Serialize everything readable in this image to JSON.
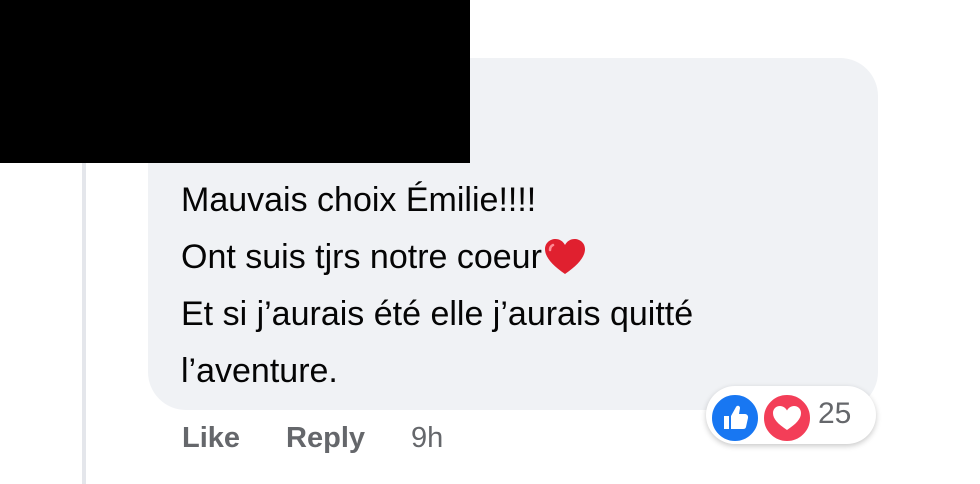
{
  "comment": {
    "lines": [
      "Mauvais choix Émilie!!!!",
      "Ont suis tjrs notre coeur",
      "Et si j’aurais été elle j’aurais quitté",
      "l’aventure."
    ],
    "emoji": "heart-emoji"
  },
  "actions": {
    "like_label": "Like",
    "reply_label": "Reply",
    "timestamp": "9h"
  },
  "reactions": {
    "icons": [
      "like-reaction-icon",
      "love-reaction-icon"
    ],
    "count": "25"
  },
  "colors": {
    "bubble": "#f0f2f5",
    "text": "#050505",
    "secondary_text": "#65676b",
    "like_blue": "#1877f2",
    "love_red": "#f33e58",
    "heart_emoji": "#e0202f",
    "redaction": "#000000"
  }
}
